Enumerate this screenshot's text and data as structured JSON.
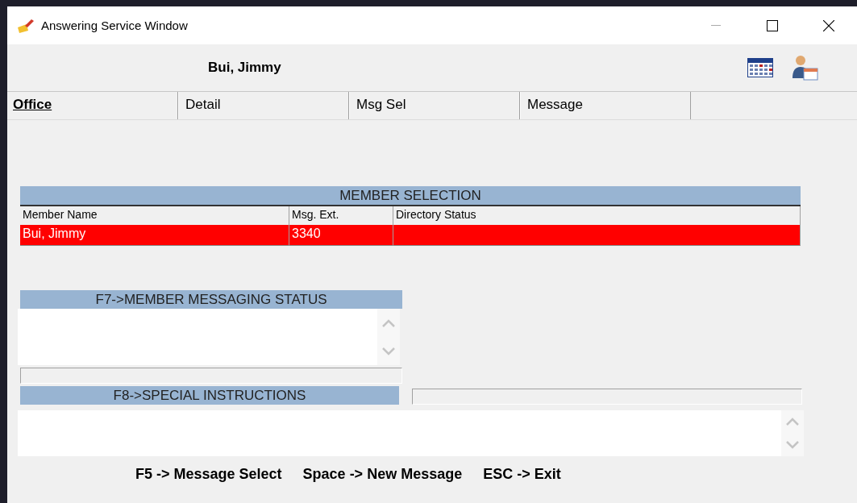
{
  "window": {
    "title": "Answering Service Window"
  },
  "header": {
    "name": "Bui, Jimmy"
  },
  "tabs": [
    {
      "label": "Office",
      "selected": true
    },
    {
      "label": "Detail",
      "selected": false
    },
    {
      "label": "Msg Sel",
      "selected": false
    },
    {
      "label": "Message",
      "selected": false
    }
  ],
  "member_selection": {
    "title": "MEMBER SELECTION",
    "columns": [
      "Member Name",
      "Msg. Ext.",
      "Directory Status"
    ],
    "rows": [
      {
        "cells": [
          "Bui, Jimmy",
          "3340"
        ],
        "selected": true
      }
    ]
  },
  "messaging_status": {
    "title": "F7->MEMBER MESSAGING STATUS"
  },
  "special_instructions": {
    "title": "F8->SPECIAL INSTRUCTIONS"
  },
  "shortcuts": [
    "F5 -> Message Select",
    "Space -> New Message",
    "ESC -> Exit"
  ]
}
